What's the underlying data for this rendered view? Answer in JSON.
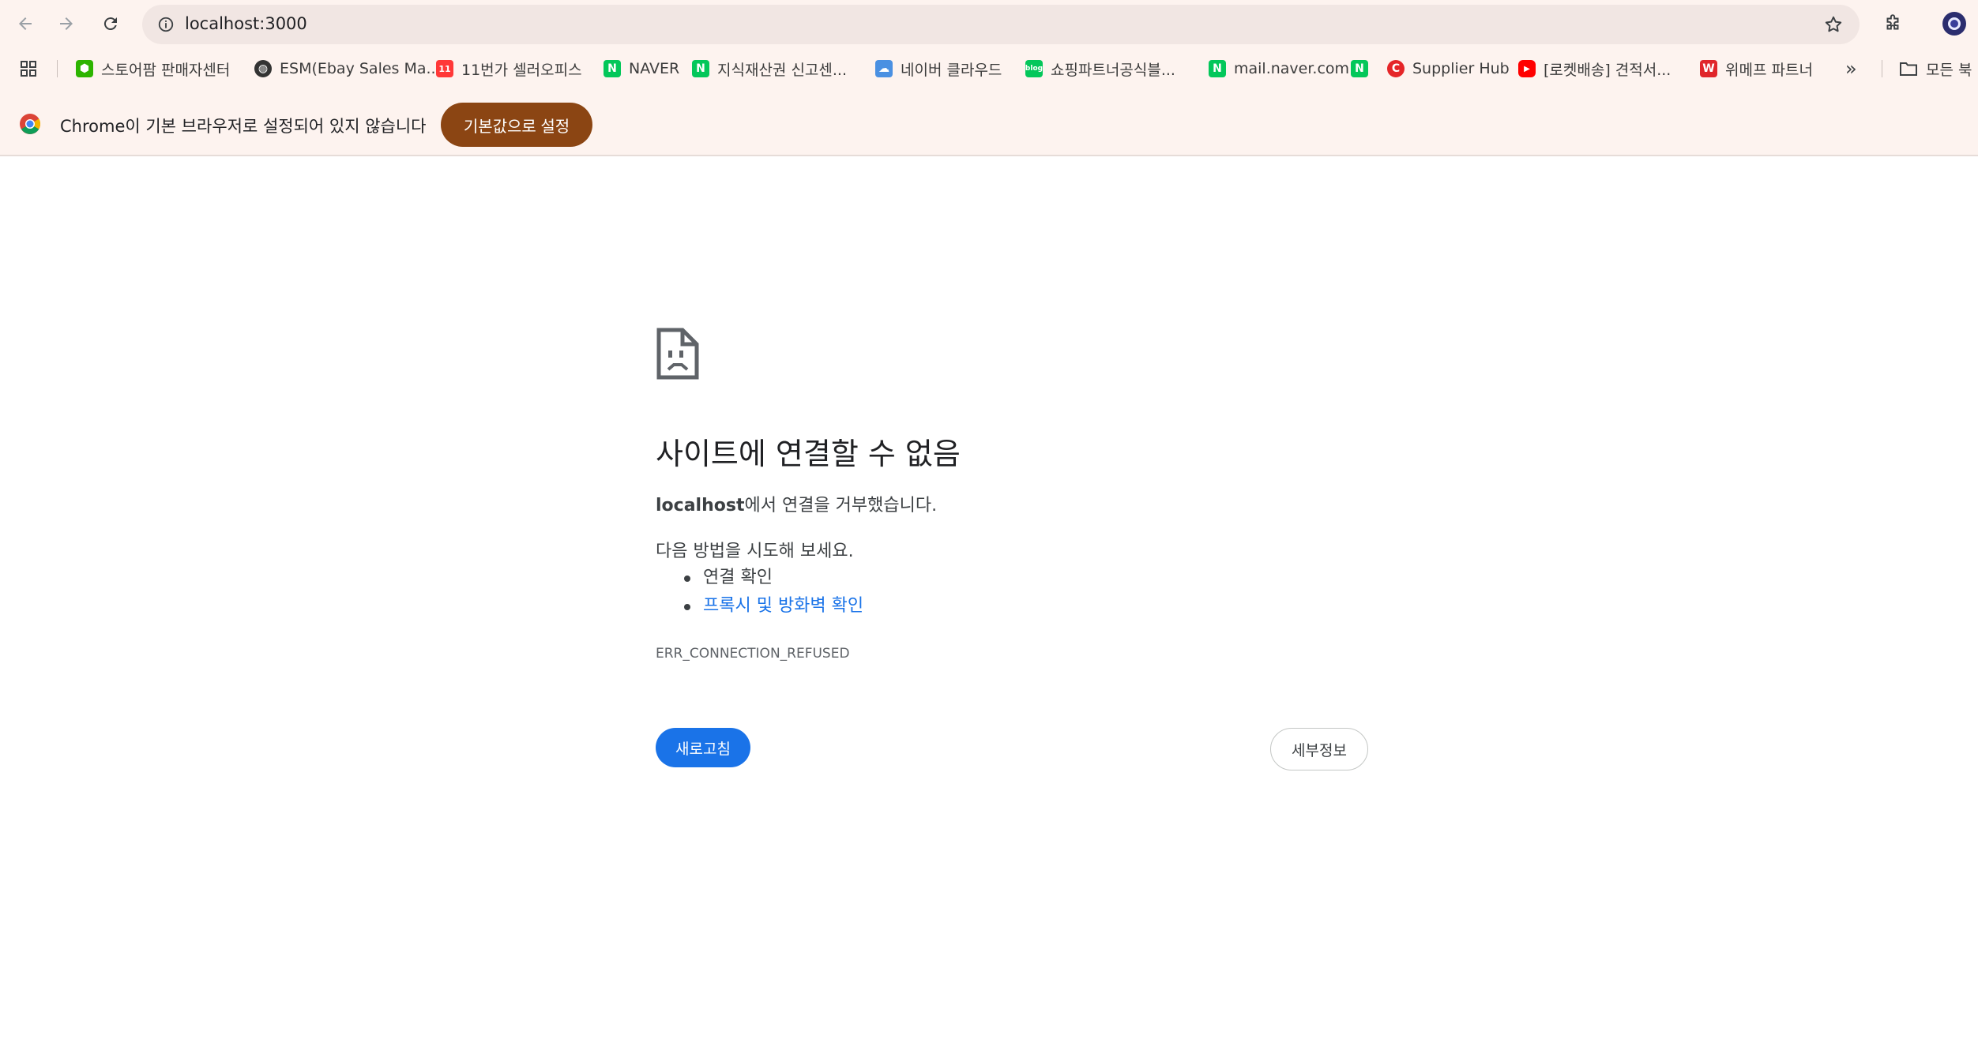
{
  "toolbar": {
    "url": "localhost:3000"
  },
  "bookmarks": [
    {
      "label": "스토어팜 판매자센터",
      "icon": "storefarm-icon",
      "color": "#2db400"
    },
    {
      "label": "ESM(Ebay Sales Ma...",
      "icon": "globe-icon",
      "color": "#333333"
    },
    {
      "label": "11번가 셀러오피스",
      "icon": "11st-icon",
      "color": "#ff3838"
    },
    {
      "label": "NAVER",
      "icon": "naver-icon",
      "color": "#03c75a"
    },
    {
      "label": "지식재산권 신고센...",
      "icon": "naver-icon",
      "color": "#03c75a"
    },
    {
      "label": "네이버 클라우드",
      "icon": "naver-cloud-icon",
      "color": "#4a90e2"
    },
    {
      "label": "쇼핑파트너공식블...",
      "icon": "blog-icon",
      "color": "#03c75a"
    },
    {
      "label": "mail.naver.com",
      "icon": "naver-icon",
      "color": "#03c75a"
    },
    {
      "label": "",
      "icon": "naver-icon",
      "color": "#03c75a"
    },
    {
      "label": "Supplier Hub",
      "icon": "coupang-icon",
      "color": "#e52528"
    },
    {
      "label": "[로켓배송] 견적서...",
      "icon": "youtube-icon",
      "color": "#ff0000"
    },
    {
      "label": "위메프 파트너",
      "icon": "wemakeprice-icon",
      "color": "#e0262b"
    }
  ],
  "bookmarks_folder": "모든 북",
  "infobar": {
    "message": "Chrome이 기본 브라우저로 설정되어 있지 않습니다",
    "button": "기본값으로 설정"
  },
  "error": {
    "title": "사이트에 연결할 수 없음",
    "host": "localhost",
    "host_suffix": "에서 연결을 거부했습니다.",
    "try_label": "다음 방법을 시도해 보세요.",
    "suggestion_1": "연결 확인",
    "suggestion_2": "프록시 및 방화벽 확인",
    "code": "ERR_CONNECTION_REFUSED",
    "reload_label": "새로고침",
    "details_label": "세부정보"
  },
  "colors": {
    "accent": "#1a73e8",
    "infobar_button": "#8b4513",
    "chrome_bg": "#fdf3ef"
  }
}
